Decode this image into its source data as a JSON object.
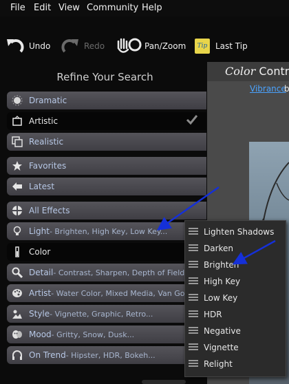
{
  "menu": [
    "File",
    "Edit",
    "View",
    "Community",
    "Help"
  ],
  "toolbar": {
    "undo": "Undo",
    "redo": "Redo",
    "pan": "Pan/Zoom",
    "tip_icon": "Tip",
    "last_tip": "Last Tip"
  },
  "refine": {
    "title": "Refine Your Search",
    "rows": [
      {
        "label": "Dramatic",
        "sub": "",
        "icon": "dramatic-icon"
      },
      {
        "label": "Artistic",
        "sub": "",
        "icon": "frame-icon",
        "checked": true
      },
      {
        "label": "Realistic",
        "sub": "",
        "icon": "stacked-frames-icon"
      },
      {
        "label": "Favorites",
        "sub": "",
        "icon": "star-icon"
      },
      {
        "label": "Latest",
        "sub": "",
        "icon": "arrow-left-icon"
      },
      {
        "label": "All Effects",
        "sub": "",
        "icon": "grid-circle-icon"
      },
      {
        "label": "Light",
        "sub": " - Brighten, High Key, Low Key...",
        "icon": "lightbulb-icon"
      },
      {
        "label": "Color",
        "sub": "",
        "icon": "thermometer-icon"
      },
      {
        "label": "Detail",
        "sub": " - Contrast, Sharpen, Depth of Field...",
        "icon": "magnifier-icon"
      },
      {
        "label": "Artist",
        "sub": " - Water Color, Mixed Media, Van Gogh...",
        "icon": "palette-icon"
      },
      {
        "label": "Style",
        "sub": " - Vignette, Graphic, Retro...",
        "icon": "landscape-icon"
      },
      {
        "label": "Mood",
        "sub": " - Gritty, Snow, Dusk...",
        "icon": "masks-icon"
      },
      {
        "label": "On Trend",
        "sub": " - Hipster, HDR, Bokeh...",
        "icon": "headphones-icon"
      }
    ]
  },
  "preview": {
    "title_italic": "Color",
    "title_rest": " Contrib",
    "link": "Vibrance",
    "link_after": "b"
  },
  "popup": {
    "items": [
      "Lighten Shadows",
      "Darken",
      "Brighten",
      "High Key",
      "Low Key",
      "HDR",
      "Negative",
      "Vignette",
      "Relight"
    ]
  },
  "colors": {
    "accent_link": "#4aa3ff",
    "arrow": "#1530d8",
    "row_text": "#b7c8e6"
  }
}
